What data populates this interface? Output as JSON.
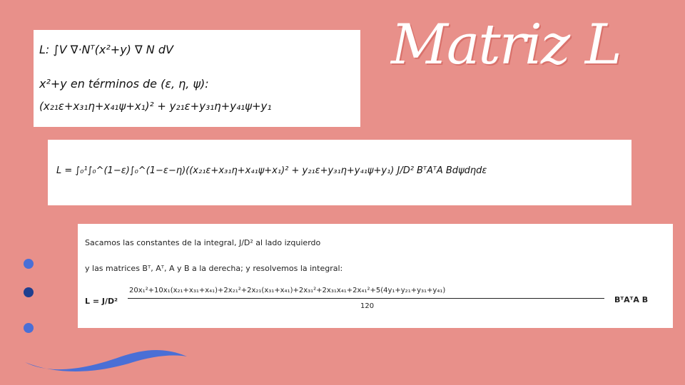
{
  "title": "Matriz L",
  "box1": {
    "line1": "L: ∫V ∇·Nᵀ(x²+y) ∇ N dV",
    "line2": "x²+y en términos de (ε, η, ψ):",
    "line3": "(x₂₁ε+x₃₁η+x₄₁ψ+x₁)² + y₂₁ε+y₃₁η+y₄₁ψ+y₁"
  },
  "box2": {
    "equation": "L = ∫₀¹∫₀^(1−ε)∫₀^(1−ε−η)((x₂₁ε+x₃₁η+x₄₁ψ+x₁)² + y₂₁ε+y₃₁η+y₄₁ψ+y₁) J/D² BᵀAᵀA Bdψdηdε"
  },
  "box3": {
    "line1": "Sacamos las constantes de la integral, J/D² al lado izquierdo",
    "line2": "y las matrices Bᵀ, Aᵀ, A y B a la derecha; y resolvemos la integral:",
    "numerator": "20x₁²+10x₁(x₂₁+x₃₁+x₄₁)+2x₂₁²+2x₂₁(x₃₁+x₄₁)+2x₃₁²+2x₃₁x₄₁+2x₄₁²+5(4y₁+y₂₁+y₃₁+y₄₁)",
    "denominator": "120",
    "prefix": "L = J/D²",
    "suffix": "BᵀAᵀA B"
  },
  "colors": {
    "background": "#e8908a",
    "dot1": "#4a6fd6",
    "dot2": "#1f3f8f",
    "dot3": "#4a6fd6",
    "wave": "#4a6fd6"
  }
}
